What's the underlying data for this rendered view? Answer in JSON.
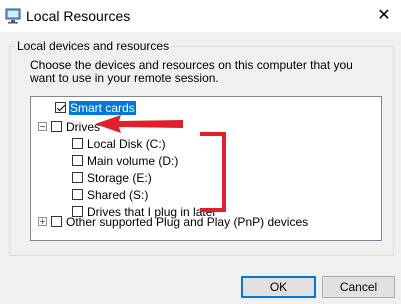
{
  "window": {
    "title": "Local Resources",
    "icon": "remote-desktop-icon",
    "close_glyph": "✕"
  },
  "group": {
    "legend": "Local devices and resources",
    "description": "Choose the devices and resources on this computer that you want to use in your remote session."
  },
  "tree": {
    "smart_cards": {
      "label": "Smart cards",
      "checked": true,
      "selected": true
    },
    "drives": {
      "label": "Drives",
      "expander": "−",
      "checked": false,
      "children": [
        {
          "label": "Local Disk (C:)",
          "checked": false
        },
        {
          "label": "Main volume (D:)",
          "checked": false
        },
        {
          "label": "Storage (E:)",
          "checked": false
        },
        {
          "label": "Shared (S:)",
          "checked": false
        },
        {
          "label": "Drives that I plug in later",
          "checked": false
        }
      ]
    },
    "other": {
      "label": "Other supported Plug and Play (PnP) devices",
      "expander": "+",
      "checked": false
    }
  },
  "annotations": {
    "color": "#e0202a"
  },
  "buttons": {
    "ok": "OK",
    "cancel": "Cancel"
  }
}
